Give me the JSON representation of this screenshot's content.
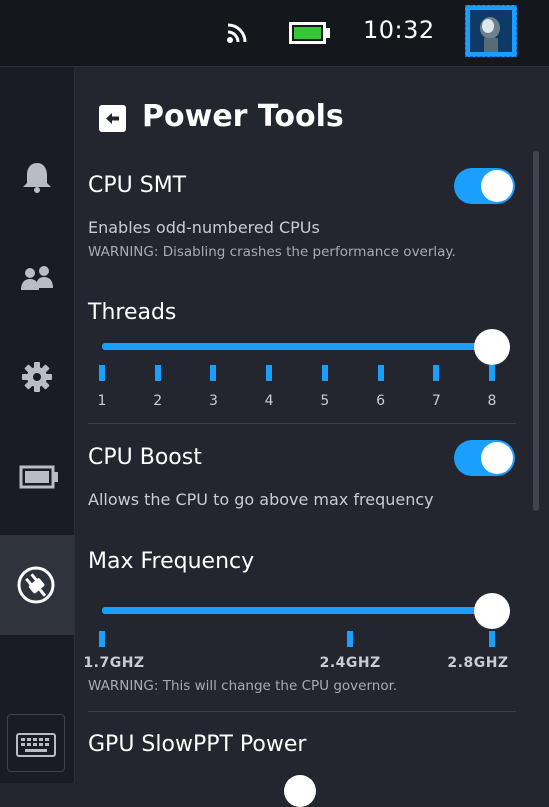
{
  "status_bar": {
    "time": "10:32",
    "icons": [
      "wifi-icon",
      "battery-icon"
    ],
    "battery_color": "#32c832"
  },
  "sidebar": {
    "items": [
      {
        "name": "notifications",
        "icon": "bell-icon"
      },
      {
        "name": "friends",
        "icon": "people-icon"
      },
      {
        "name": "settings",
        "icon": "gear-icon"
      },
      {
        "name": "performance",
        "icon": "battery-icon"
      },
      {
        "name": "power-tools",
        "icon": "power-plug-icon",
        "selected": true
      }
    ],
    "bottom": {
      "icon": "keyboard-icon"
    }
  },
  "header": {
    "title": "Power Tools",
    "back_icon": "back-arrow-icon"
  },
  "settings": {
    "cpu_smt": {
      "label": "CPU SMT",
      "enabled": true,
      "description": "Enables odd-numbered CPUs",
      "warning": "WARNING: Disabling crashes the performance overlay."
    },
    "threads": {
      "label": "Threads",
      "value": 8,
      "min": 1,
      "max": 8,
      "ticks": [
        "1",
        "2",
        "3",
        "4",
        "5",
        "6",
        "7",
        "8"
      ]
    },
    "cpu_boost": {
      "label": "CPU Boost",
      "enabled": true,
      "description": "Allows the CPU to go above max frequency"
    },
    "max_frequency": {
      "label": "Max Frequency",
      "value_ghz": 2.8,
      "ticks": [
        "1.7GHZ",
        "2.4GHZ",
        "2.8GHZ"
      ],
      "warning": "WARNING: This will change the CPU governor."
    },
    "gpu_slowppt": {
      "label": "GPU SlowPPT Power"
    }
  },
  "theme": {
    "accent": "#1a9fff",
    "background": "#23262e",
    "sidebar_bg": "#191c22",
    "topbar_bg": "#14171c"
  }
}
